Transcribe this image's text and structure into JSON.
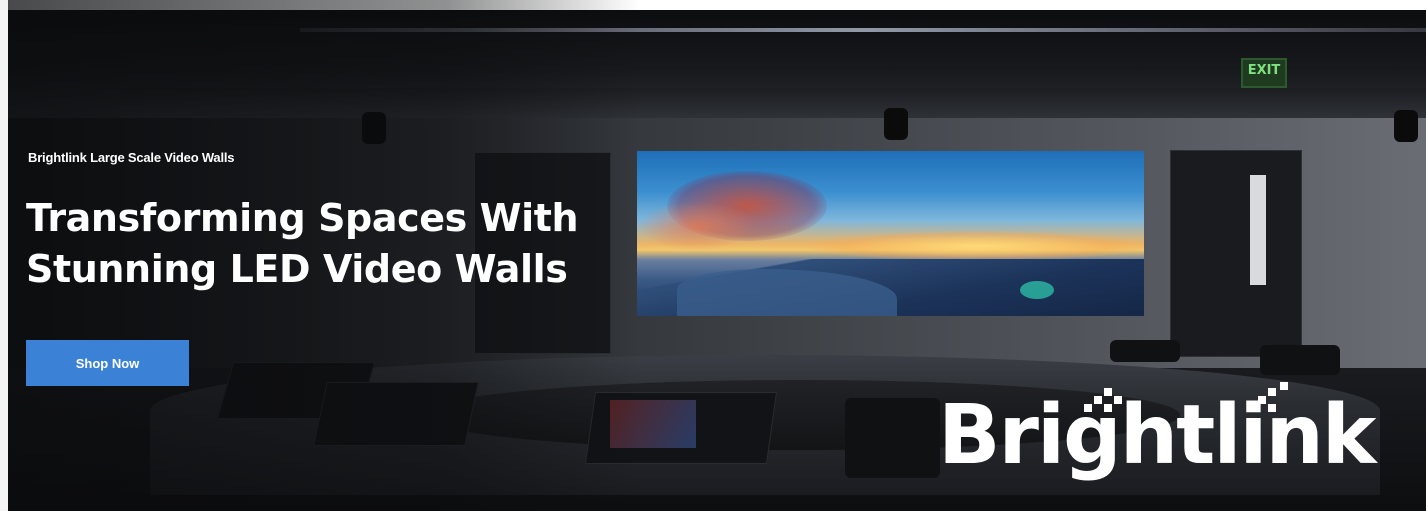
{
  "hero": {
    "eyebrow": "Brightlink Large Scale Video Walls",
    "headline_line1": "Transforming Spaces With",
    "headline_line2": "Stunning LED Video Walls",
    "cta_label": "Shop Now",
    "accent_color": "#3b82d6"
  },
  "scene": {
    "exit_sign": "EXIT"
  },
  "brand": {
    "logo_text": "Brightlink"
  }
}
